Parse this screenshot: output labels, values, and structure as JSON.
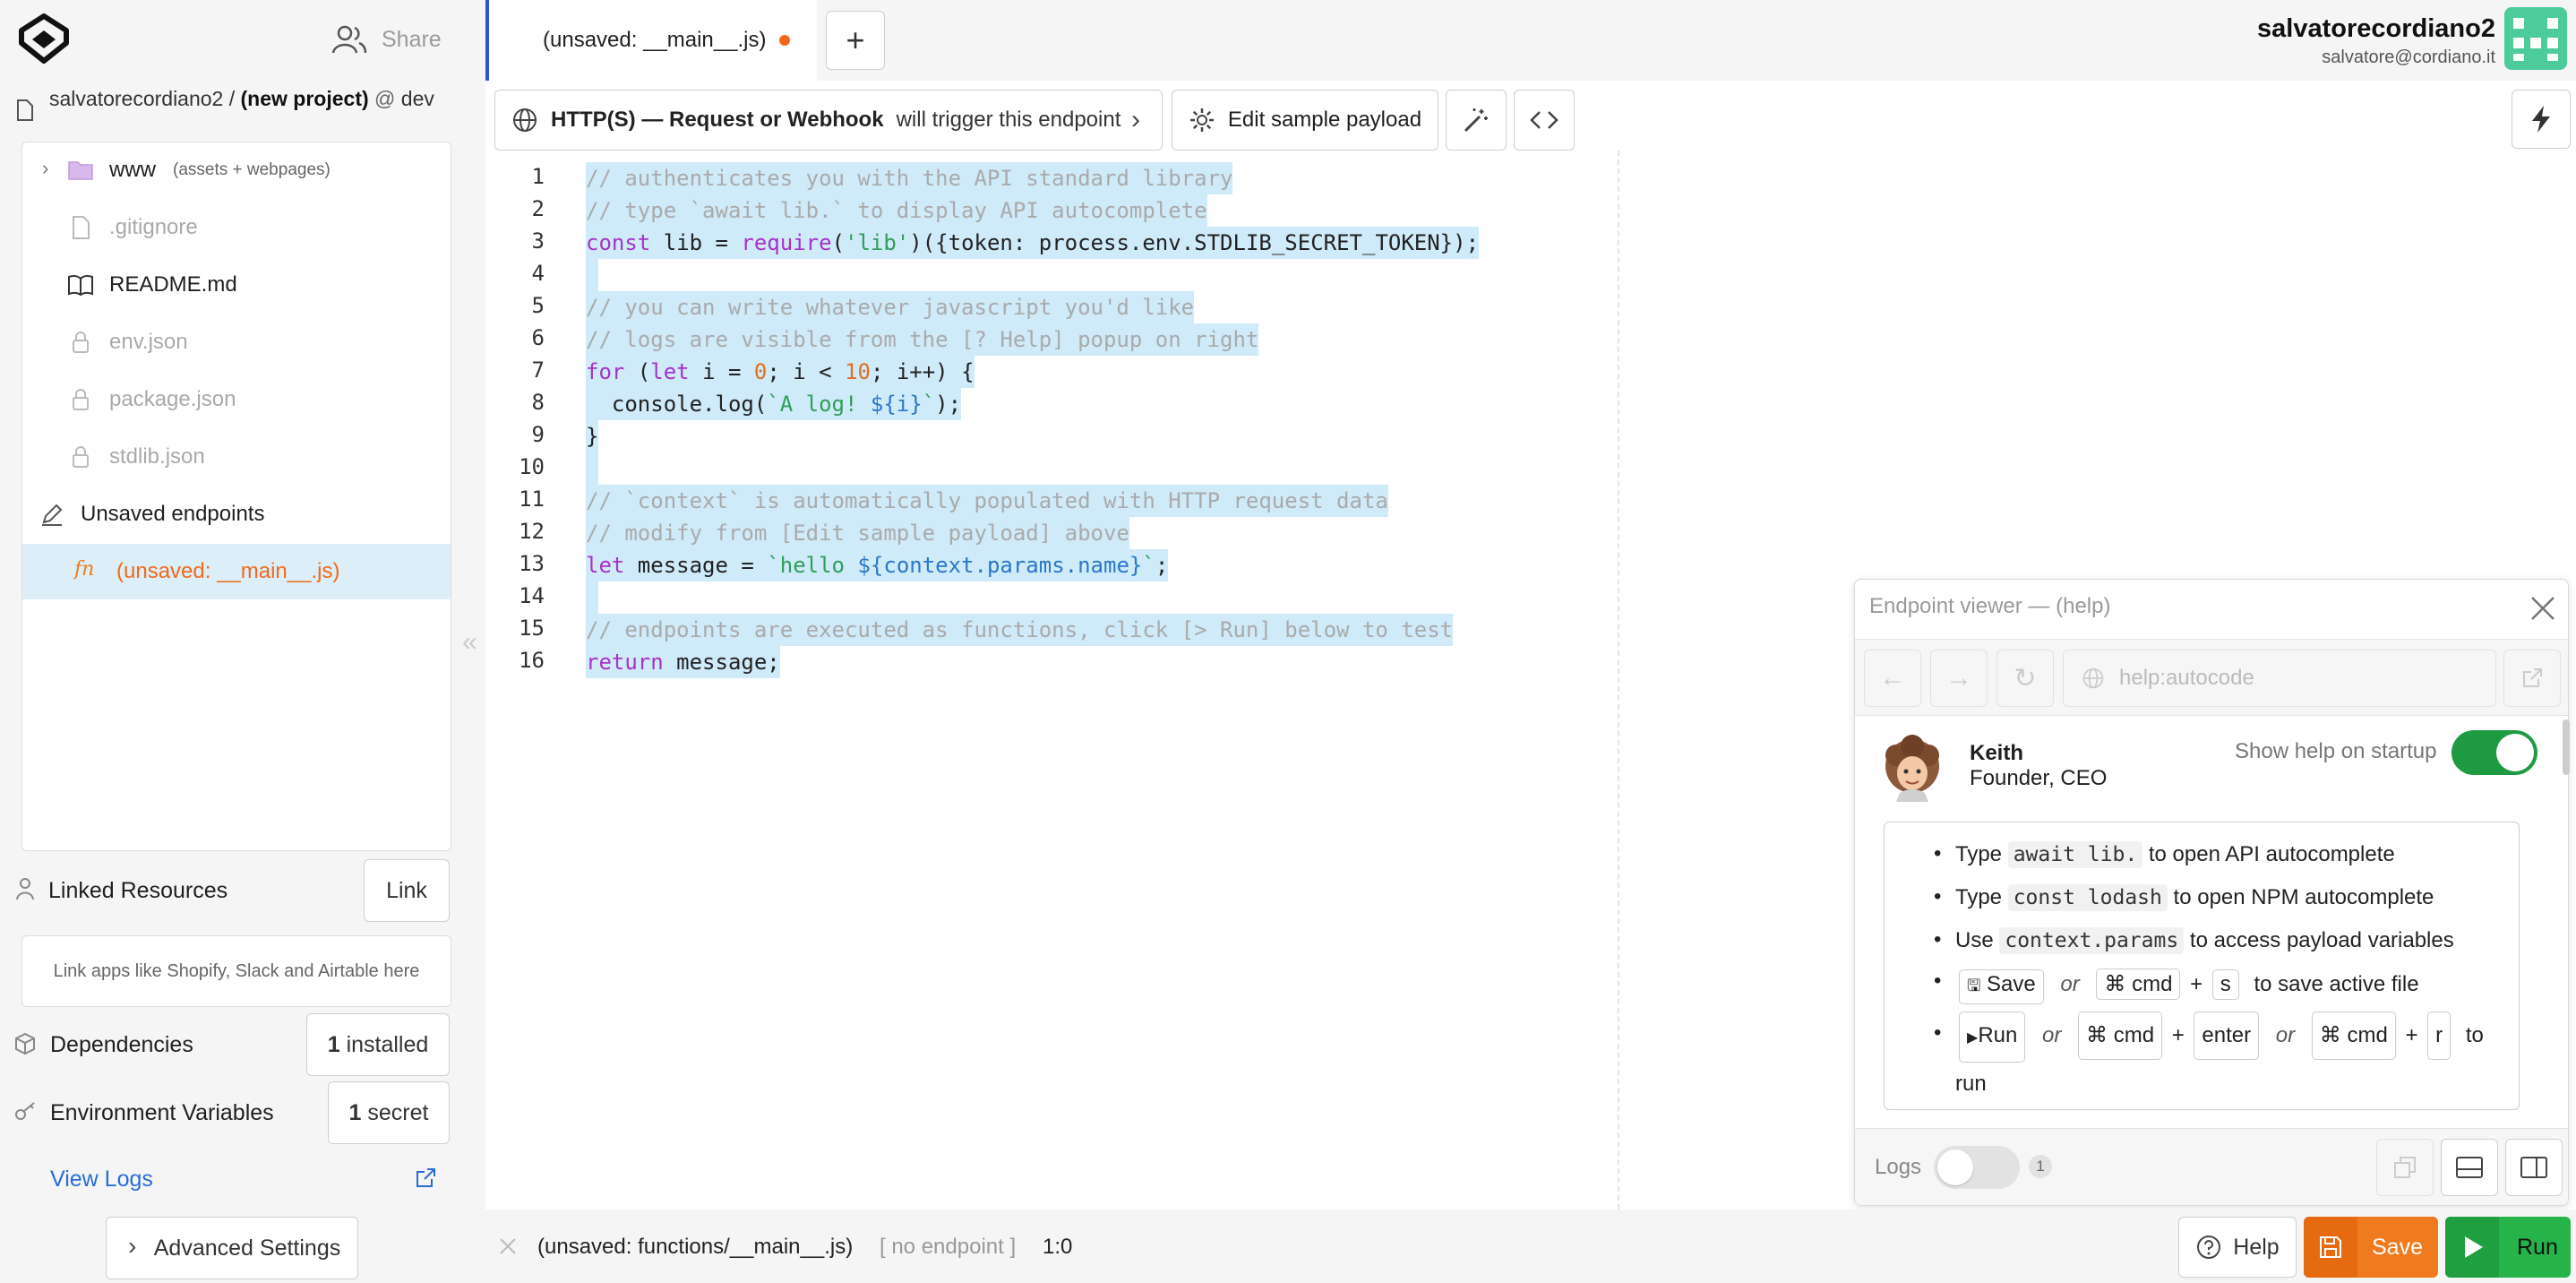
{
  "sidebar": {
    "share_label": "Share",
    "breadcrumb": {
      "user": "salvatorecordiano2",
      "separator": "/",
      "project": "(new project)",
      "at": "@",
      "env": "dev"
    },
    "tree": [
      {
        "label": "www",
        "note": "(assets + webpages)",
        "icon": "folder-icon"
      },
      {
        "label": ".gitignore",
        "icon": "file-icon"
      },
      {
        "label": "README.md",
        "icon": "book-icon"
      },
      {
        "label": "env.json",
        "icon": "lock-icon"
      },
      {
        "label": "package.json",
        "icon": "lock-icon"
      },
      {
        "label": "stdlib.json",
        "icon": "lock-icon"
      },
      {
        "label": "Unsaved endpoints",
        "icon": "pencil-icon"
      },
      {
        "label": "(unsaved: __main__.js)",
        "icon": "function-icon"
      }
    ],
    "linked_resources": {
      "label": "Linked Resources",
      "button": "Link",
      "hint": "Link apps like Shopify, Slack and Airtable here"
    },
    "dependencies": {
      "label": "Dependencies",
      "count": "1",
      "suffix": "installed"
    },
    "env_vars": {
      "label": "Environment Variables",
      "count": "1",
      "suffix": "secret"
    },
    "view_logs": "View Logs",
    "advanced_settings": "Advanced Settings",
    "collapse_glyph": "«"
  },
  "tabs": {
    "active": "(unsaved: __main__.js)",
    "add": "+"
  },
  "user": {
    "name": "salvatorecordiano2",
    "email": "salvatore@cordiano.it"
  },
  "toolbar": {
    "trigger_bold": "HTTP(S) — Request or Webhook",
    "trigger_rest": "will trigger this endpoint",
    "edit_payload": "Edit sample payload"
  },
  "code": {
    "line_numbers": [
      "1",
      "2",
      "3",
      "4",
      "5",
      "6",
      "7",
      "8",
      "9",
      "10",
      "11",
      "12",
      "13",
      "14",
      "15",
      "16"
    ],
    "l1": "// authenticates you with the API standard library",
    "l2": "// type `await lib.` to display API autocomplete",
    "l3a": "const",
    "l3b": " lib = ",
    "l3c": "require",
    "l3d": "(",
    "l3e": "'lib'",
    "l3f": ")({token: process.env.STDLIB_SECRET_TOKEN});",
    "l5": "// you can write whatever javascript you'd like",
    "l6": "// logs are visible from the [? Help] popup on right",
    "l7a": "for",
    "l7b": " (",
    "l7c": "let",
    "l7d": " i = ",
    "l7e": "0",
    "l7f": "; i < ",
    "l7g": "10",
    "l7h": "; i++) {",
    "l8a": "  console.log(",
    "l8b": "`A log! ",
    "l8c": "${i}",
    "l8d": "`",
    "l8e": ");",
    "l9": "}",
    "l11": "// `context` is automatically populated with HTTP request data",
    "l12": "// modify from [Edit sample payload] above",
    "l13a": "let",
    "l13b": " message = ",
    "l13c": "`hello ",
    "l13d": "${context.params.name}",
    "l13e": "`",
    "l13f": ";",
    "l15": "// endpoints are executed as functions, click [> Run] below to test",
    "l16a": "return",
    "l16b": " message;"
  },
  "viewer": {
    "title": "Endpoint viewer — (help)",
    "url": "help:autocode",
    "person_name": "Keith",
    "person_role": "Founder, CEO",
    "startup_toggle_label": "Show help on startup",
    "tips": {
      "t1a": "Type",
      "t1code": "await lib.",
      "t1b": "to open API autocomplete",
      "t2a": "Type",
      "t2code": "const lodash",
      "t2b": "to open NPM autocomplete",
      "t3a": "Use",
      "t3code": "context.params",
      "t3b": "to access payload variables",
      "t4save": "Save",
      "or": "or",
      "cmd": "cmd",
      "s": "s",
      "plus": "+",
      "t4b": "to save active file",
      "t5run": "Run",
      "enter": "enter",
      "r": "r",
      "t5b": "to",
      "t5c": "run"
    },
    "logs_label": "Logs",
    "logs_count": "1"
  },
  "status": {
    "file": "(unsaved: functions/__main__.js)",
    "endpoint": "[ no endpoint ]",
    "cursor": "1:0",
    "help": "Help",
    "save": "Save",
    "run": "Run"
  },
  "colors": {
    "accent_blue": "#2a55d6",
    "save_orange": "#f07a1e",
    "run_green": "#26b34a",
    "selection": "#cfeaf9",
    "unsaved": "#f06a1a"
  }
}
